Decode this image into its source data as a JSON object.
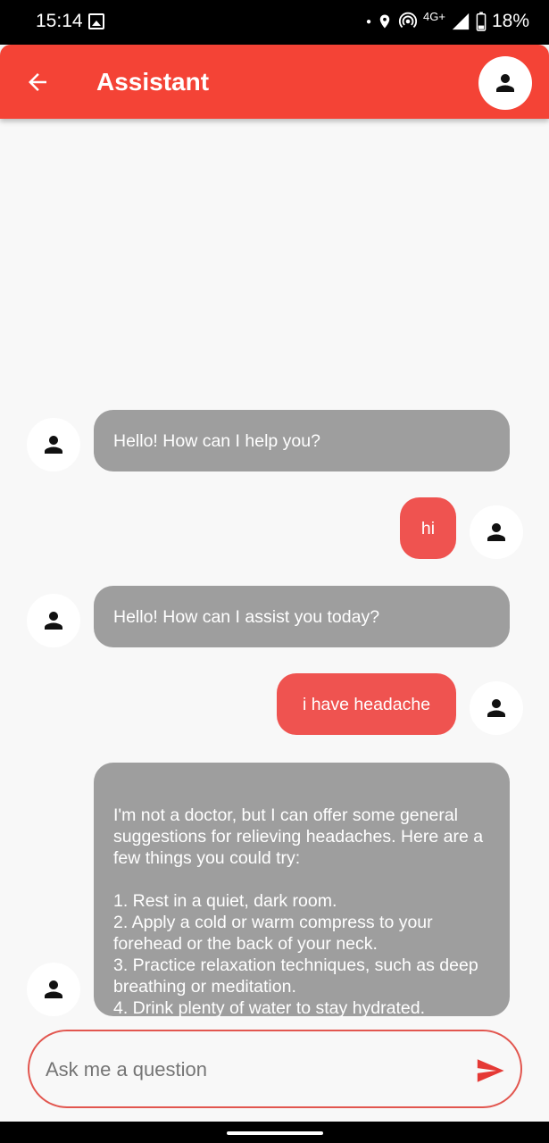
{
  "status_bar": {
    "time": "15:14",
    "network": "4G",
    "network_suffix": "+",
    "battery": "18%"
  },
  "app_bar": {
    "title": "Assistant",
    "color": "#f44336"
  },
  "messages": [
    {
      "sender": "bot",
      "text": "Hello! How can I help you?"
    },
    {
      "sender": "user",
      "text": "hi"
    },
    {
      "sender": "bot",
      "text": "Hello! How can I assist you today?"
    },
    {
      "sender": "user",
      "text": "i have headache"
    },
    {
      "sender": "bot",
      "text": "I'm not a doctor, but I can offer some general suggestions for relieving headaches. Here are a few things you could try:\n\n1. Rest in a quiet, dark room.\n2. Apply a cold or warm compress to your forehead or the back of your neck.\n3. Practice relaxation techniques, such as deep breathing or meditation.\n4. Drink plenty of water to stay hydrated."
    }
  ],
  "input": {
    "placeholder": "Ask me a question",
    "value": ""
  },
  "icons": {
    "back": "arrow-back-icon",
    "profile": "person-icon",
    "send": "send-icon"
  },
  "colors": {
    "bot_bubble": "#9e9e9e",
    "user_bubble": "#ef5350",
    "background": "#f8f8f8"
  }
}
